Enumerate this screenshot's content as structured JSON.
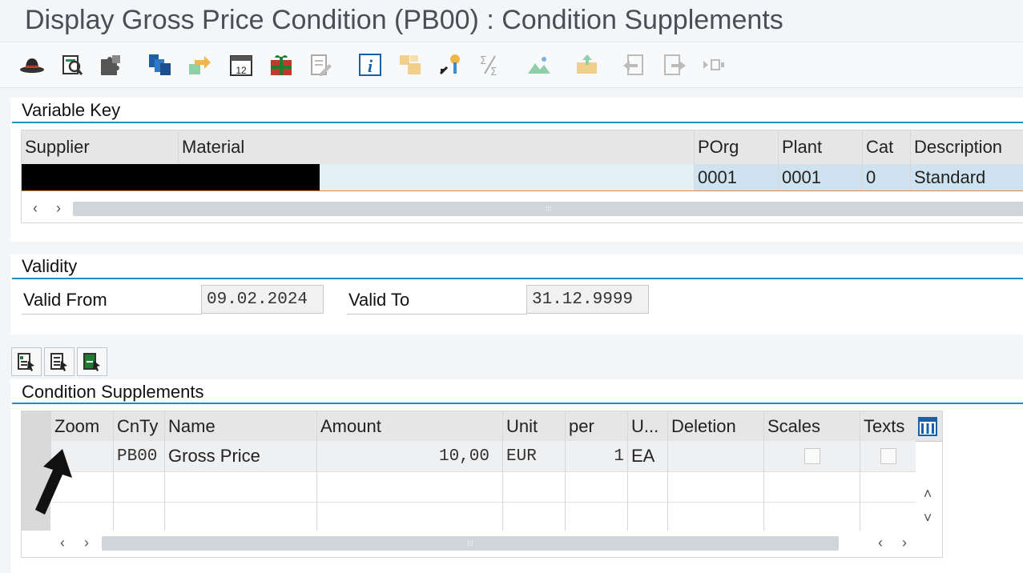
{
  "window": {
    "title": "Display Gross Price Condition (PB00) : Condition Supplements"
  },
  "toolbar": {
    "icons": [
      "hat-icon",
      "overview-icon",
      "puzzle-icon",
      "cascade-icon",
      "transfer-icon",
      "calendar-icon",
      "gift-icon",
      "edit-document-icon",
      "info-icon",
      "copy-icon",
      "key-icon",
      "sum-icon",
      "landscape-icon",
      "export-icon",
      "back-document-icon",
      "forward-document-icon",
      "more-icon"
    ],
    "calendar_day": "12"
  },
  "variable_key": {
    "title": "Variable Key",
    "columns": [
      "Supplier",
      "Material",
      "POrg",
      "Plant",
      "Cat",
      "Description"
    ],
    "row": {
      "supplier": "",
      "material": "",
      "porg": "0001",
      "plant": "0001",
      "cat": "0",
      "description": "Standard"
    }
  },
  "validity": {
    "title": "Validity",
    "valid_from_label": "Valid From",
    "valid_from": "09.02.2024",
    "valid_to_label": "Valid To",
    "valid_to": "31.12.9999"
  },
  "condition_supplements": {
    "title": "Condition Supplements",
    "columns": [
      "Zoom",
      "CnTy",
      "Name",
      "Amount",
      "Unit",
      "per",
      "U...",
      "Deletion",
      "Scales",
      "Texts"
    ],
    "rows": [
      {
        "cnty": "PB00",
        "name": "Gross Price",
        "amount": "10,00",
        "unit": "EUR",
        "per": "1",
        "uom": "EA",
        "deletion": "",
        "scales": false,
        "texts": false
      }
    ]
  },
  "scroll": {
    "grip": "⁞⁞⁞"
  }
}
